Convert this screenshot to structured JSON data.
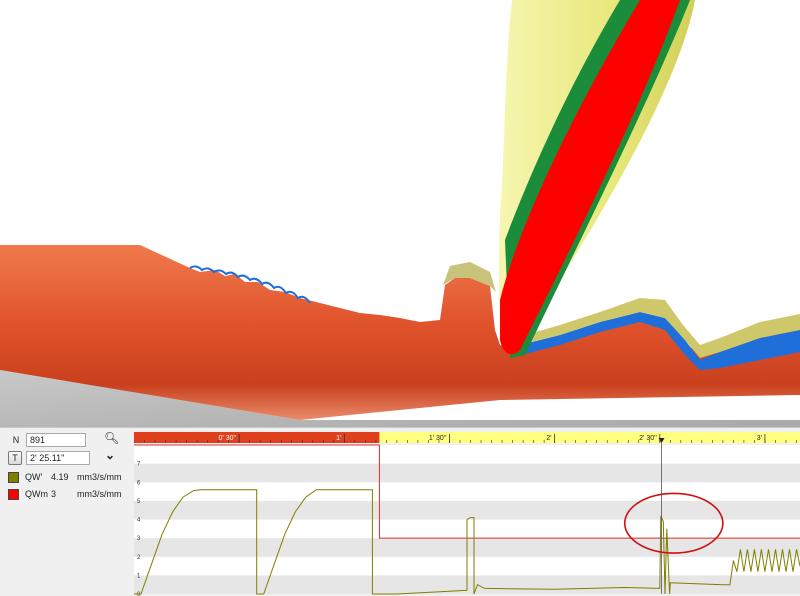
{
  "window": {
    "panel": {
      "n_label": "N",
      "n_value": "891",
      "t_label": "T",
      "t_value": "2' 25.11''",
      "legend": [
        {
          "name": "QW'",
          "value": "4.19",
          "unit": "mm3/s/mm",
          "color": "#7f7f00"
        },
        {
          "name": "QWm",
          "value": "3",
          "unit": "mm3/s/mm",
          "color": "#ff0000"
        }
      ],
      "icons": {
        "search": "magnifier-icon",
        "expand": "double-chevron-down-icon"
      }
    }
  },
  "colors": {
    "workpiece": "#e0532c",
    "tool_outer": "#f0ef88",
    "tool_red": "#ff0000",
    "chip_blue": "#1e6fd9",
    "timeline_elapsed": "#e0401e",
    "timeline_remaining": "#ffff80",
    "highlight_circle": "#d01010"
  },
  "chart_data": {
    "type": "line",
    "x_unit": "seconds",
    "xlim": [
      0,
      190
    ],
    "ylim": [
      0,
      8
    ],
    "x_tick_labels": [
      {
        "x": 30,
        "label": "0' 30''"
      },
      {
        "x": 60,
        "label": "1'"
      },
      {
        "x": 90,
        "label": "1' 30''"
      },
      {
        "x": 120,
        "label": "2'"
      },
      {
        "x": 150,
        "label": "2' 30''"
      },
      {
        "x": 180,
        "label": "3'"
      }
    ],
    "y_tick_labels": [
      "0",
      "1",
      "2",
      "3",
      "4",
      "5",
      "6",
      "7"
    ],
    "elapsed_until": 70,
    "cursor_x": 150.5,
    "series": [
      {
        "name": "QWm",
        "color": "#d43030",
        "points": [
          [
            0,
            8.2
          ],
          [
            70,
            8.2
          ],
          [
            70,
            3.0
          ],
          [
            190,
            3.0
          ]
        ]
      },
      {
        "name": "QW'",
        "color": "#7f7f00",
        "points": [
          [
            0,
            0
          ],
          [
            2,
            0
          ],
          [
            5,
            1.6
          ],
          [
            8,
            3.2
          ],
          [
            11,
            4.4
          ],
          [
            14,
            5.2
          ],
          [
            17,
            5.55
          ],
          [
            19,
            5.6
          ],
          [
            35,
            5.6
          ],
          [
            35,
            0
          ],
          [
            37,
            0
          ],
          [
            40,
            1.6
          ],
          [
            43,
            3.2
          ],
          [
            46,
            4.4
          ],
          [
            49,
            5.2
          ],
          [
            52,
            5.6
          ],
          [
            68,
            5.6
          ],
          [
            68,
            0
          ],
          [
            75,
            0
          ],
          [
            90,
            0.15
          ],
          [
            95,
            0.2
          ],
          [
            95,
            4.0
          ],
          [
            96,
            4.1
          ],
          [
            97,
            4.1
          ],
          [
            97,
            0
          ],
          [
            98,
            0.5
          ],
          [
            100,
            0.3
          ],
          [
            120,
            0.25
          ],
          [
            130,
            0.3
          ],
          [
            140,
            0.35
          ],
          [
            150,
            0.3
          ],
          [
            150.3,
            4.19
          ],
          [
            151,
            3.9
          ],
          [
            151.5,
            0
          ],
          [
            152,
            3.5
          ],
          [
            152.8,
            0
          ],
          [
            153,
            0.6
          ],
          [
            168,
            0.5
          ],
          [
            170,
            0.5
          ],
          [
            171,
            1.8
          ],
          [
            172,
            1.2
          ],
          [
            173,
            2.4
          ],
          [
            174,
            1.2
          ],
          [
            175,
            2.4
          ],
          [
            176,
            1.2
          ],
          [
            177,
            2.4
          ],
          [
            178,
            1.2
          ],
          [
            179,
            2.4
          ],
          [
            180,
            1.2
          ],
          [
            181,
            2.4
          ],
          [
            182,
            1.2
          ],
          [
            183,
            2.4
          ],
          [
            184,
            1.2
          ],
          [
            185,
            2.4
          ],
          [
            186,
            1.2
          ],
          [
            187,
            2.4
          ],
          [
            188,
            1.2
          ],
          [
            189,
            2.4
          ],
          [
            190,
            1.5
          ]
        ]
      }
    ],
    "annotation": {
      "type": "ellipse",
      "cx": 154,
      "cy": 3.8,
      "rx": 14,
      "ry": 1.6,
      "color": "#d01010"
    }
  }
}
